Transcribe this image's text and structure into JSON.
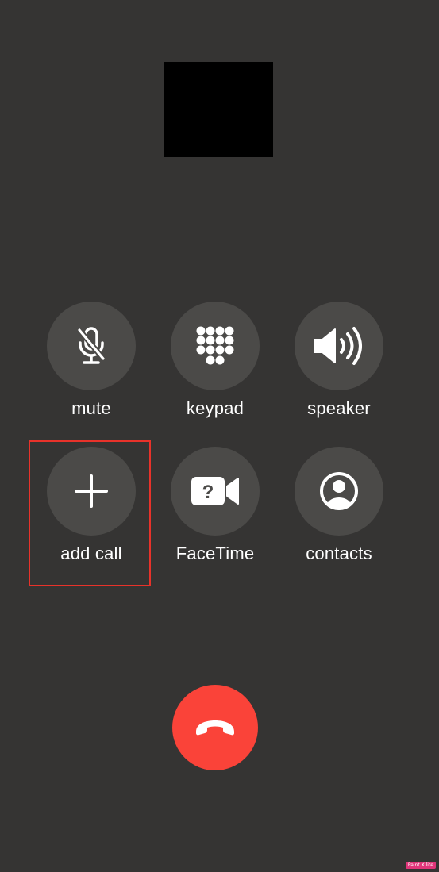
{
  "controls": {
    "mute": {
      "label": "mute",
      "icon": "mic-slash-icon"
    },
    "keypad": {
      "label": "keypad",
      "icon": "keypad-grid-icon"
    },
    "speaker": {
      "label": "speaker",
      "icon": "speaker-wave-icon"
    },
    "add_call": {
      "label": "add call",
      "icon": "plus-icon"
    },
    "facetime": {
      "label": "FaceTime",
      "icon": "video-camera-question-icon"
    },
    "contacts": {
      "label": "contacts",
      "icon": "person-circle-icon"
    }
  },
  "end_call": {
    "icon": "phone-hangup-icon"
  },
  "colors": {
    "background": "#353433",
    "button": "#4b4a48",
    "end_call": "#fa4339",
    "highlight": "#e8322a"
  },
  "watermark": "Paint X lite"
}
